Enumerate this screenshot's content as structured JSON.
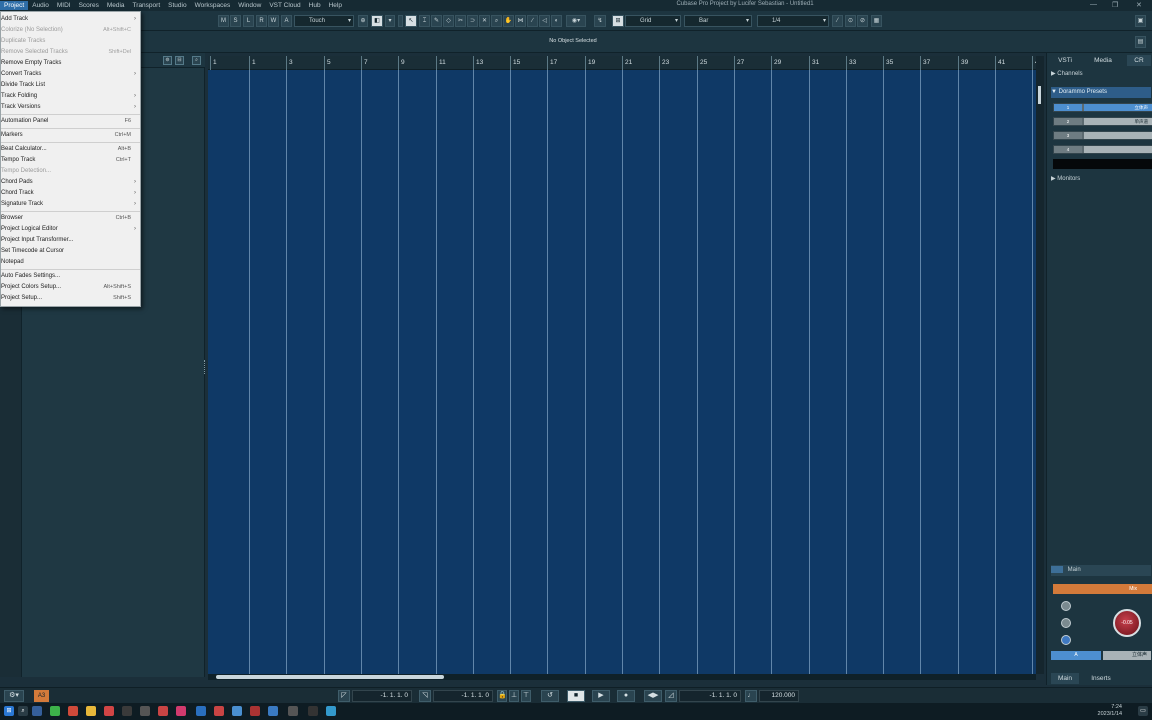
{
  "titlebar": {
    "menus": [
      "Project",
      "Audio",
      "MIDI",
      "Scores",
      "Media",
      "Transport",
      "Studio",
      "Workspaces",
      "Window",
      "VST Cloud",
      "Hub",
      "Help"
    ],
    "window_title": "Cubase Pro Project by Lucifer Sebastian - Untitled1"
  },
  "toolbar": {
    "btn_m": "M",
    "btn_s": "S",
    "btn_l": "L",
    "btn_r": "R",
    "btn_w": "W",
    "btn_a": "A",
    "automation_mode": "Touch",
    "snap_type": "Grid",
    "grid_type": "Bar",
    "quantize": "1/4"
  },
  "infoline": {
    "text": "No Object Selected"
  },
  "ruler": {
    "labels": [
      "1",
      "1",
      "3",
      "5",
      "7",
      "9",
      "11",
      "13",
      "15",
      "17",
      "19",
      "21",
      "23",
      "25",
      "27",
      "29",
      "31",
      "33",
      "35",
      "37",
      "39",
      "41",
      "4"
    ]
  },
  "right_zone": {
    "tabs": [
      "VSTi",
      "Media",
      "CR"
    ],
    "channels": "Channels",
    "presets_header": "Dorammo Presets",
    "preset_rows": [
      {
        "num": "1",
        "name": "立体声",
        "on": true
      },
      {
        "num": "2",
        "name": "单声道",
        "on": false
      },
      {
        "num": "3",
        "name": "",
        "on": false
      },
      {
        "num": "4",
        "name": "",
        "on": false
      }
    ],
    "monitors": "Monitors",
    "main_label": "Main",
    "mix_label": "Mix",
    "knob_value": "-0.05",
    "bottom_a": "A",
    "bottom_stereo": "立体声",
    "bottom_tabs": [
      "Main",
      "Inserts"
    ]
  },
  "transport": {
    "left_locator": "-1. 1. 1.   0",
    "right_locator": "-1. 1. 1.   0",
    "position": "-1. 1. 1.   0",
    "tempo": "120.000",
    "track_badge": "A3"
  },
  "menu": {
    "items": [
      {
        "label": "Add Track",
        "shortcut": "",
        "sub": true,
        "disabled": false
      },
      {
        "label": "Colorize (No Selection)",
        "shortcut": "Alt+Shift+C",
        "sub": false,
        "disabled": true
      },
      {
        "label": "Duplicate Tracks",
        "shortcut": "",
        "sub": false,
        "disabled": true
      },
      {
        "label": "Remove Selected Tracks",
        "shortcut": "Shift+Del",
        "sub": false,
        "disabled": true
      },
      {
        "label": "Remove Empty Tracks",
        "shortcut": "",
        "sub": false,
        "disabled": false
      },
      {
        "label": "Convert Tracks",
        "shortcut": "",
        "sub": true,
        "disabled": false
      },
      {
        "label": "Divide Track List",
        "shortcut": "",
        "sub": false,
        "disabled": false
      },
      {
        "label": "Track Folding",
        "shortcut": "",
        "sub": true,
        "disabled": false
      },
      {
        "label": "Track Versions",
        "shortcut": "",
        "sub": true,
        "disabled": false
      },
      {
        "label": "Automation Panel",
        "shortcut": "F6",
        "sub": false,
        "disabled": false
      },
      {
        "label": "Markers",
        "shortcut": "Ctrl+M",
        "sub": false,
        "disabled": false
      },
      {
        "label": "Beat Calculator...",
        "shortcut": "Alt+B",
        "sub": false,
        "disabled": false
      },
      {
        "label": "Tempo Track",
        "shortcut": "Ctrl+T",
        "sub": false,
        "disabled": false
      },
      {
        "label": "Tempo Detection...",
        "shortcut": "",
        "sub": false,
        "disabled": true
      },
      {
        "label": "Chord Pads",
        "shortcut": "",
        "sub": true,
        "disabled": false
      },
      {
        "label": "Chord Track",
        "shortcut": "",
        "sub": true,
        "disabled": false
      },
      {
        "label": "Signature Track",
        "shortcut": "",
        "sub": true,
        "disabled": false
      },
      {
        "label": "Browser",
        "shortcut": "Ctrl+B",
        "sub": false,
        "disabled": false
      },
      {
        "label": "Project Logical Editor",
        "shortcut": "",
        "sub": true,
        "disabled": false
      },
      {
        "label": "Project Input Transformer...",
        "shortcut": "",
        "sub": false,
        "disabled": false
      },
      {
        "label": "Set Timecode at Cursor",
        "shortcut": "",
        "sub": false,
        "disabled": false
      },
      {
        "label": "Notepad",
        "shortcut": "",
        "sub": false,
        "disabled": false
      },
      {
        "label": "Auto Fades Settings...",
        "shortcut": "",
        "sub": false,
        "disabled": false
      },
      {
        "label": "Project Colors Setup...",
        "shortcut": "Alt+Shift+S",
        "sub": false,
        "disabled": false
      },
      {
        "label": "Project Setup...",
        "shortcut": "Shift+S",
        "sub": false,
        "disabled": false
      }
    ]
  },
  "taskbar": {
    "time": "7:24",
    "date": "2023/1/14"
  }
}
